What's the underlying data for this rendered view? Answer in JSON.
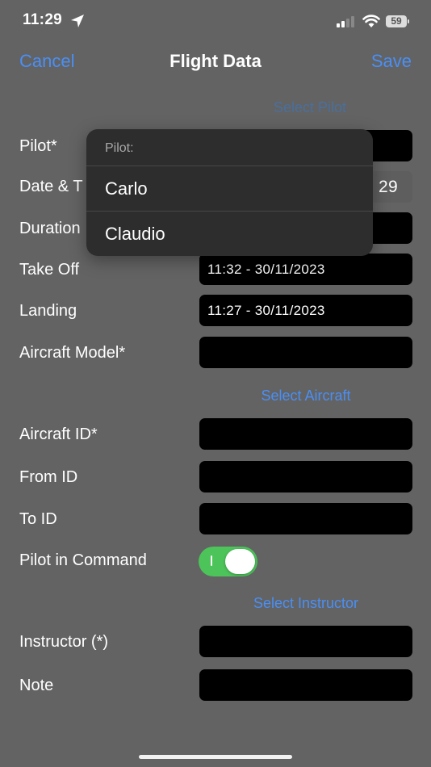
{
  "status_bar": {
    "time": "11:29",
    "battery": "59"
  },
  "nav": {
    "cancel": "Cancel",
    "title": "Flight Data",
    "save": "Save"
  },
  "links": {
    "select_pilot": "Select Pilot",
    "select_aircraft": "Select Aircraft",
    "select_instructor": "Select Instructor"
  },
  "form": {
    "pilot_label": "Pilot*",
    "date_label": "Date & T",
    "date_value_visible": "29",
    "duration_label": "Duration",
    "takeoff_label": "Take Off",
    "takeoff_value": "11:32 - 30/11/2023",
    "landing_label": "Landing",
    "landing_value": "11:27 - 30/11/2023",
    "aircraft_model_label": "Aircraft Model*",
    "aircraft_id_label": "Aircraft ID*",
    "from_id_label": "From ID",
    "to_id_label": "To ID",
    "pic_label": "Pilot in Command",
    "pic_on": true,
    "instructor_label": "Instructor (*)",
    "note_label": "Note"
  },
  "popup": {
    "header": "Pilot:",
    "options": [
      "Carlo",
      "Claudio"
    ]
  }
}
